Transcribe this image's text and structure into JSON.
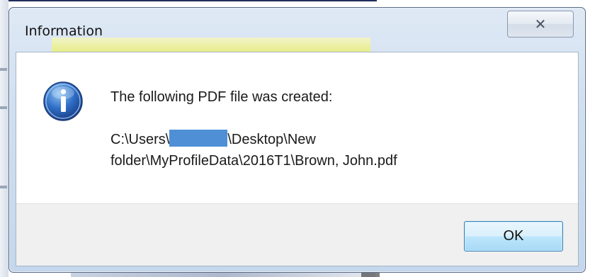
{
  "dialog": {
    "title": "Information",
    "close_icon": "close-icon",
    "message": "The following PDF file was created:",
    "path": {
      "prefix": "C:\\Users\\",
      "suffix_line1": "\\Desktop\\New",
      "line2": "folder\\MyProfileData\\2016T1\\Brown, John.pdf"
    },
    "icon": "info-icon",
    "ok_label": "OK"
  },
  "colors": {
    "redaction": "#4f8fd6",
    "titlebar": "#cfdff0",
    "button_accent": "#3c7fb1"
  }
}
